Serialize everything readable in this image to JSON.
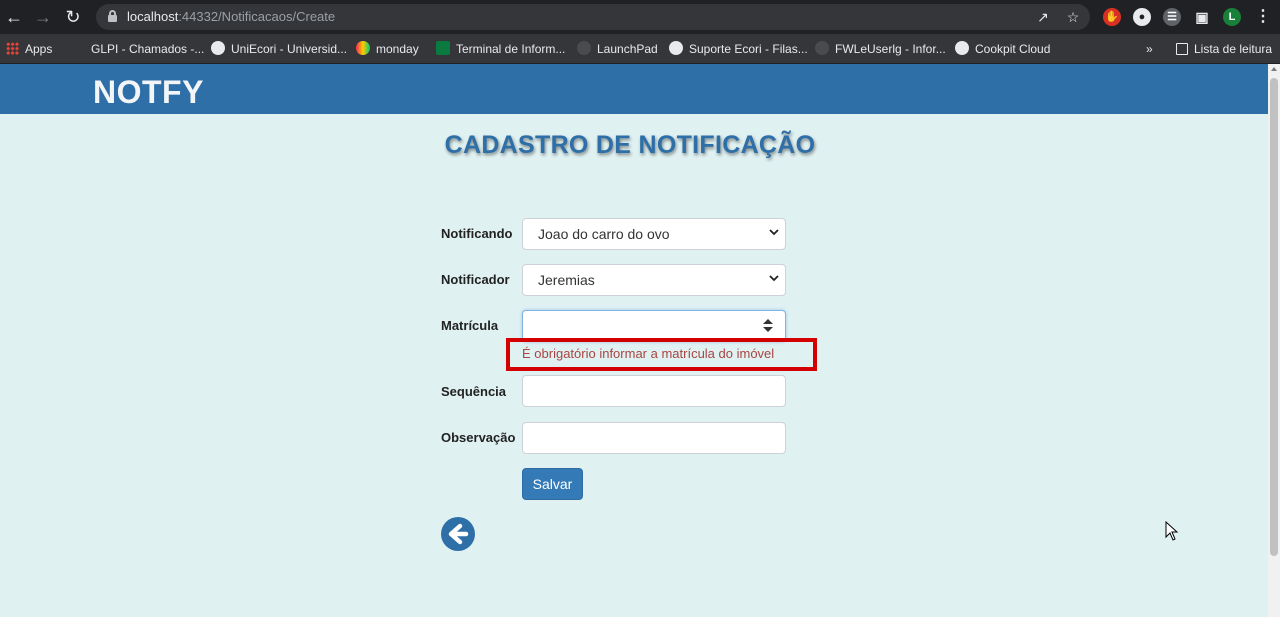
{
  "browser": {
    "url_host": "localhost",
    "url_rest": ":44332/Notificacaos/Create",
    "profile_initial": "L",
    "bookmarks": [
      {
        "label": "Apps"
      },
      {
        "label": "GLPI - Chamados -..."
      },
      {
        "label": "UniEcori - Universid..."
      },
      {
        "label": "monday"
      },
      {
        "label": "Terminal de Inform..."
      },
      {
        "label": "LaunchPad"
      },
      {
        "label": "Suporte Ecori - Filas..."
      },
      {
        "label": "FWLeUserlg - Infor..."
      },
      {
        "label": "Cookpit Cloud"
      }
    ],
    "more_bookmarks": "»",
    "reading_list": "Lista de leitura"
  },
  "navbar": {
    "brand": "NOTFY"
  },
  "page": {
    "title": "CADASTRO DE NOTIFICAÇÃO"
  },
  "form": {
    "notificando": {
      "label": "Notificando",
      "value": "Joao do carro do ovo"
    },
    "notificador": {
      "label": "Notificador",
      "value": "Jeremias"
    },
    "matricula": {
      "label": "Matrícula",
      "value": "",
      "error": "É obrigatório informar a matrícula do imóvel"
    },
    "sequencia": {
      "label": "Sequência",
      "value": ""
    },
    "observacao": {
      "label": "Observação",
      "value": ""
    },
    "save_label": "Salvar"
  },
  "colors": {
    "navbar": "#2f6fa7",
    "background": "#e0f1f2",
    "error_highlight": "#d40000",
    "button": "#337ab7"
  }
}
